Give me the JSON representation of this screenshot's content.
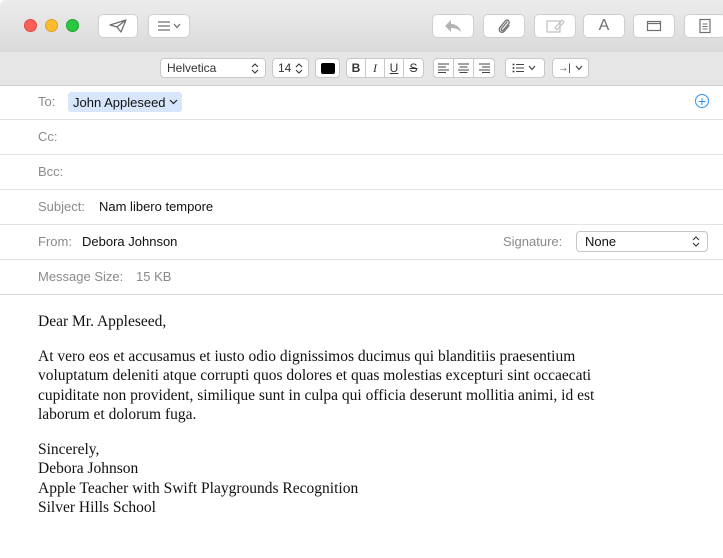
{
  "toolbar": {
    "buttons": [
      "send",
      "header-fields",
      "reply",
      "attach",
      "photo-browser",
      "fonts",
      "window",
      "format"
    ]
  },
  "format_bar": {
    "font": "Helvetica",
    "size": "14",
    "bold": "B",
    "italic": "I",
    "underline": "U",
    "strikethrough": "S",
    "indent_label": "→|"
  },
  "header": {
    "to_label": "To:",
    "to_recipient": "John Appleseed",
    "cc_label": "Cc:",
    "bcc_label": "Bcc:",
    "subject_label": "Subject:",
    "subject_value": "Nam libero tempore",
    "from_label": "From:",
    "from_value": "Debora Johnson",
    "signature_label": "Signature:",
    "signature_value": "None",
    "size_label": "Message Size:",
    "size_value": "15 KB"
  },
  "message": {
    "greeting": "Dear Mr. Appleseed,",
    "paragraph_lines": [
      "At vero eos et accusamus et iusto odio dignissimos ducimus qui blanditiis praesentium",
      "voluptatum deleniti atque corrupti quos dolores et quas molestias excepturi sint occaecati",
      "cupiditate non provident, similique sunt in culpa qui officia deserunt mollitia animi, id est",
      "laborum et dolorum fuga."
    ],
    "closing": "Sincerely,",
    "signature_lines": [
      "Debora Johnson",
      "Apple Teacher with Swift Playgrounds Recognition",
      "Silver Hills School"
    ]
  },
  "colors": {
    "accent": "#2e93f4",
    "token_bg": "#d7e6fb",
    "close": "#fc5f57",
    "minimize": "#fdbc2e",
    "zoom": "#2ac840"
  }
}
